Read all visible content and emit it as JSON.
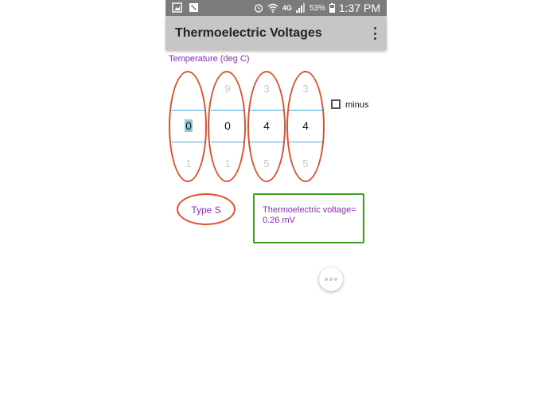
{
  "status_bar": {
    "network": "4G",
    "battery": "53%",
    "time": "1:37 PM",
    "icons": [
      "image-icon",
      "pen-icon",
      "alarm-icon",
      "wifi-icon",
      "signal-icon",
      "battery-icon"
    ]
  },
  "app_bar": {
    "title": "Thermoelectric Voltages",
    "menu_icon": "more-vert-icon"
  },
  "temperature": {
    "label": "Temperature (deg C)",
    "pickers": [
      {
        "prev": "",
        "current": "0",
        "next": "1"
      },
      {
        "prev": "9",
        "current": "0",
        "next": "1"
      },
      {
        "prev": "3",
        "current": "4",
        "next": "5"
      },
      {
        "prev": "3",
        "current": "4",
        "next": "5"
      }
    ],
    "minus_label": "minus",
    "minus_checked": false
  },
  "thermocouple": {
    "type_label": "Type S"
  },
  "result": {
    "line1": "Thermoelectric voltage=",
    "line2": "0.26 mV"
  },
  "colors": {
    "accent_text": "#8a2bbd",
    "annotation_red": "#e0502f",
    "annotation_green": "#3aa020",
    "appbar": "#c6c6c6",
    "statusbar": "#7b7b7b"
  }
}
